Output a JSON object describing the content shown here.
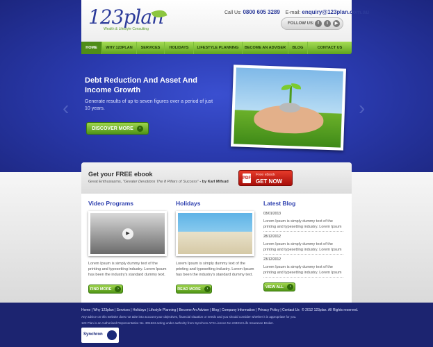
{
  "header": {
    "logo_text": "123plan",
    "logo_sub": "Wealth & Lifestyle Consulting",
    "call_label": "Call Us:",
    "phone": "0800 605 3289",
    "email_label": "E-mail:",
    "email": "enquiry@123plan.com.au",
    "follow_label": "FOLLOW US:",
    "social": [
      {
        "icon": "facebook-icon",
        "glyph": "f"
      },
      {
        "icon": "twitter-icon",
        "glyph": "t"
      },
      {
        "icon": "youtube-icon",
        "glyph": "▶"
      }
    ]
  },
  "nav": {
    "items": [
      {
        "label": "HOME",
        "active": true
      },
      {
        "label": "WHY 123PLAN"
      },
      {
        "label": "SERVICES"
      },
      {
        "label": "HOLIDAYS"
      },
      {
        "label": "LIFESTYLE PLANNING"
      },
      {
        "label": "BECOME AN ADVISER"
      },
      {
        "label": "BLOG"
      },
      {
        "label": "CONTACT US"
      }
    ]
  },
  "hero": {
    "title": "Debt Reduction And Asset And Income Growth",
    "text": "Generate results of up to seven figures over a period of just 10 years.",
    "button": "DISCOVER MORE",
    "prev": "‹",
    "next": "›"
  },
  "ebook": {
    "title": "Get your FREE ebook",
    "sub_prefix": "Great Enthusiasms,",
    "sub_book": "\"Greater Devotions The 8 Pillars of Success\"",
    "sub_author": "- by Karl Mifsud",
    "btn_small": "Free ebook",
    "btn_big": "GET NOW",
    "pdf_glyph": "PDF"
  },
  "columns": {
    "video": {
      "title": "Video Programs",
      "text": "Lorem Ipsum is simply dummy text of the printing and typesetting industry. Lorem Ipsum has been the industry's standard dummy text.",
      "button": "FIND MORE",
      "play_glyph": "▶"
    },
    "holidays": {
      "title": "Holidays",
      "text": "Lorem Ipsum is simply dummy text of the printing and typesetting industry. Lorem Ipsum has been the industry's standard dummy text.",
      "button": "READ MORE"
    },
    "blog": {
      "title": "Latest Blog",
      "posts": [
        {
          "date": "03/01/2013",
          "text": "Lorem Ipsum is simply dummy text of the printing and typesetting industry. Lorem Ipsum"
        },
        {
          "date": "28/12/2012",
          "text": "Lorem Ipsum is simply dummy text of the printing and typesetting industry. Lorem Ipsum"
        },
        {
          "date": "23/12/2012",
          "text": "Lorem Ipsum is simply dummy text of the printing and typesetting industry. Lorem Ipsum"
        }
      ],
      "button": "VIEW ALL"
    }
  },
  "footer": {
    "links": "Home | Why 123plan | Services | Holidays | Lifestyle Planning | Become An Adviser | Blog | Company Information | Privacy Policy | Contact Us",
    "copyright": "© 2012 123plan. All Rights reserved.",
    "note1": "Any advice on this website does not take into account your objectives, financial situation or needs and you should consider whether it is appropriate for you.",
    "note2": "123 Plan is an Authorised Representative No. 301624 acting under authority from Synchron AFS Licence No 243313 Life Insurance Broker.",
    "partner": "Synchron"
  },
  "colors": {
    "brand_blue": "#2d3fae",
    "nav_green": "#5ea31d",
    "cta_red": "#c0120c"
  }
}
